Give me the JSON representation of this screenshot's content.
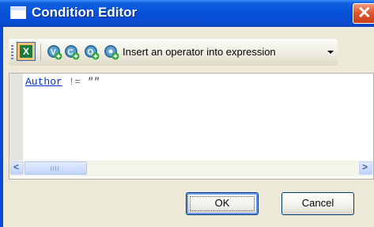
{
  "window": {
    "title": "Condition Editor"
  },
  "toolbar": {
    "insert_operator_label": "Insert an operator into expression",
    "icons": [
      "excel-icon",
      "add-field-icon",
      "add-value-icon",
      "add-operator-icon",
      "dropdown-arrow-icon"
    ]
  },
  "editor": {
    "field": "Author",
    "operator": "!=",
    "value": "\"\""
  },
  "buttons": {
    "ok": "OK",
    "cancel": "Cancel"
  },
  "colors": {
    "titlebar": "#0751d8",
    "close": "#e1572f",
    "dialog_bg": "#ece9d8",
    "field_link": "#0033dd"
  }
}
